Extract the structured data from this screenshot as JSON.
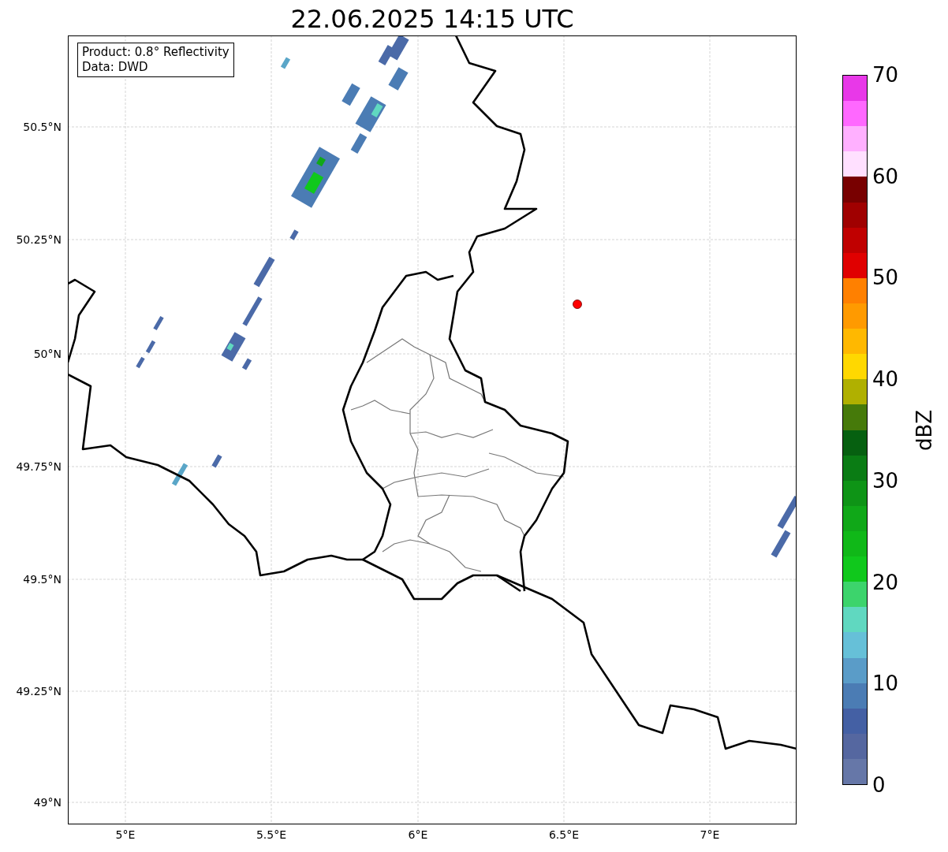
{
  "title": "22.06.2025 14:15 UTC",
  "info_box": [
    "Product: 0.8° Reflectivity",
    "Data: DWD"
  ],
  "lat_ticks": [
    "50.5°N",
    "50.25°N",
    "50°N",
    "49.75°N",
    "49.5°N",
    "49.25°N",
    "49°N"
  ],
  "lon_ticks": [
    "5°E",
    "5.5°E",
    "6°E",
    "6.5°E",
    "7°E"
  ],
  "colorbar": {
    "label": "dBZ",
    "ticks": [
      "70",
      "60",
      "50",
      "40",
      "30",
      "20",
      "10",
      "0"
    ],
    "segments": [
      {
        "color": "#e838e8"
      },
      {
        "color": "#ff68ff"
      },
      {
        "color": "#ffb0ff"
      },
      {
        "color": "#ffe0ff"
      },
      {
        "color": "#780000"
      },
      {
        "color": "#a00000"
      },
      {
        "color": "#c00000"
      },
      {
        "color": "#e00000"
      },
      {
        "color": "#ff8000"
      },
      {
        "color": "#ff9a00"
      },
      {
        "color": "#ffb800"
      },
      {
        "color": "#ffd800"
      },
      {
        "color": "#b0b000"
      },
      {
        "color": "#467a0a"
      },
      {
        "color": "#066010"
      },
      {
        "color": "#0a7c14"
      },
      {
        "color": "#0e9416"
      },
      {
        "color": "#10a818"
      },
      {
        "color": "#10b818"
      },
      {
        "color": "#10c81c"
      },
      {
        "color": "#3cd46c"
      },
      {
        "color": "#60d8c0"
      },
      {
        "color": "#66c0d8"
      },
      {
        "color": "#5a9cc8"
      },
      {
        "color": "#4b7cb4"
      },
      {
        "color": "#4460a4"
      },
      {
        "color": "#5567a0"
      },
      {
        "color": "#6677a8"
      }
    ]
  }
}
